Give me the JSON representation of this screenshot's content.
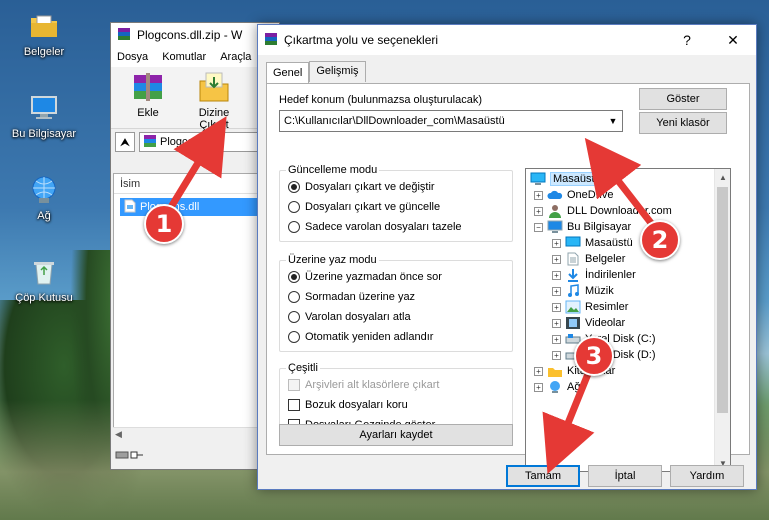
{
  "desktop": {
    "icons": [
      {
        "label": "Belgeler",
        "icon": "folder-documents-icon"
      },
      {
        "label": "Bu Bilgisayar",
        "icon": "computer-icon"
      },
      {
        "label": "Ağ",
        "icon": "network-icon"
      },
      {
        "label": "Çöp Kutusu",
        "icon": "recycle-bin-icon"
      }
    ]
  },
  "winrar": {
    "title": "Plogcons.dll.zip - W",
    "menu": [
      "Dosya",
      "Komutlar",
      "Araçla"
    ],
    "tools": [
      {
        "label": "Ekle",
        "icon": "add-archive-icon"
      },
      {
        "label": "Dizine Çıkart",
        "icon": "extract-to-icon"
      }
    ],
    "address": "Plogcons.d",
    "column_name": "İsim",
    "file_name": "Plogcons.dll"
  },
  "dialog": {
    "title": "Çıkartma yolu ve seçenekleri",
    "help": "?",
    "close": "✕",
    "tabs": [
      "Genel",
      "Gelişmiş"
    ],
    "destination_label": "Hedef konum (bulunmazsa oluşturulacak)",
    "destination_value": "C:\\Kullanıcılar\\DllDownloader_com\\Masaüstü",
    "show_button": "Göster",
    "new_folder_button": "Yeni klasör",
    "update_mode": {
      "title": "Güncelleme modu",
      "options": [
        "Dosyaları çıkart ve değiştir",
        "Dosyaları çıkart ve güncelle",
        "Sadece varolan dosyaları tazele"
      ],
      "selected": 0
    },
    "overwrite_mode": {
      "title": "Üzerine yaz modu",
      "options": [
        "Üzerine yazmadan önce sor",
        "Sormadan üzerine yaz",
        "Varolan dosyaları atla",
        "Otomatik yeniden adlandır"
      ],
      "selected": 0
    },
    "misc": {
      "title": "Çeşitli",
      "options": [
        "Arşivleri alt klasörlere çıkart",
        "Bozuk dosyaları koru",
        "Dosyaları Gezginde göster"
      ]
    },
    "save_settings": "Ayarları kaydet",
    "tree": [
      {
        "label": "Masaüstü",
        "icon": "desktop-icon"
      },
      {
        "label": "OneDrive",
        "icon": "onedrive-icon"
      },
      {
        "label": "DLL Downloader.com",
        "icon": "user-icon"
      },
      {
        "label": "Bu Bilgisayar",
        "icon": "computer-icon"
      },
      {
        "label": "Masaüstü",
        "icon": "desktop-icon"
      },
      {
        "label": "Belgeler",
        "icon": "documents-icon"
      },
      {
        "label": "İndirilenler",
        "icon": "downloads-icon"
      },
      {
        "label": "Müzik",
        "icon": "music-icon"
      },
      {
        "label": "Resimler",
        "icon": "pictures-icon"
      },
      {
        "label": "Videolar",
        "icon": "videos-icon"
      },
      {
        "label": "Yerel Disk (C:)",
        "icon": "drive-icon"
      },
      {
        "label": "Yerel Disk (D:)",
        "icon": "drive-icon"
      },
      {
        "label": "Kitaplıklar",
        "icon": "libraries-icon"
      },
      {
        "label": "Ağ",
        "icon": "network-icon"
      }
    ],
    "ok": "Tamam",
    "cancel": "İptal",
    "help_button": "Yardım"
  },
  "callouts": [
    "1",
    "2",
    "3"
  ],
  "colors": {
    "arrow": "#e53935",
    "selection": "#3399ff",
    "accent": "#0078d7"
  }
}
